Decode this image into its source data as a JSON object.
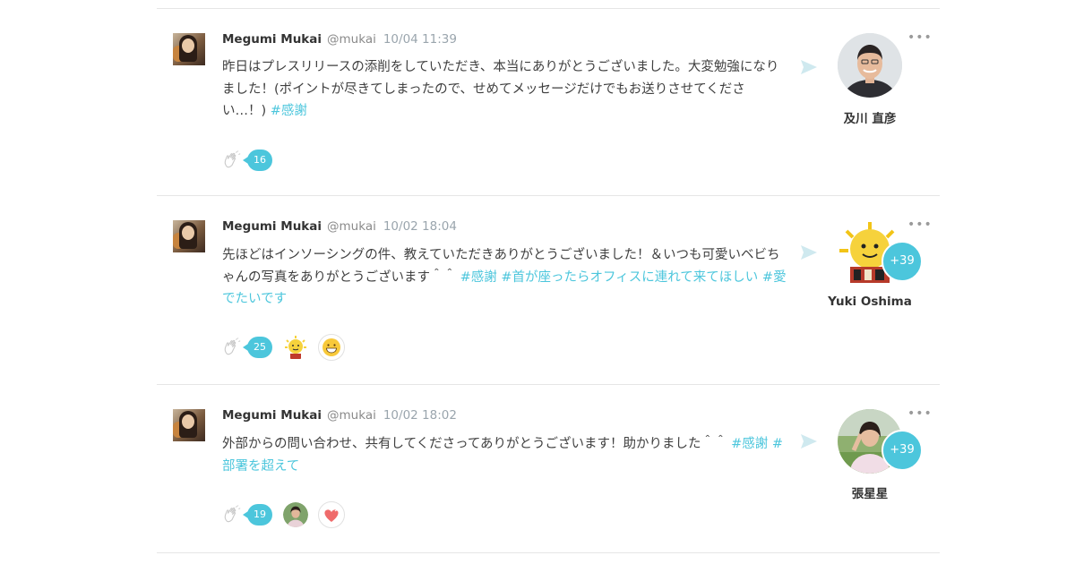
{
  "posts": [
    {
      "author": "Megumi Mukai",
      "handle": "@mukai",
      "time": "10/04 11:39",
      "body_plain": "昨日はプレスリリースの添削をしていただき、本当にありがとうございました。大変勉強になりました！(ポイントが尽きてしまったので、せめてメッセージだけでもお送りさせてください…！) ",
      "tags": [
        "#感謝"
      ],
      "clap_count": "16",
      "recipient": "及川 直彦",
      "recipient_extra": "",
      "reactions": []
    },
    {
      "author": "Megumi Mukai",
      "handle": "@mukai",
      "time": "10/02 18:04",
      "body_plain": "先ほどはインソーシングの件、教えていただきありがとうございました！＆いつも可愛いベビちゃんの写真をありがとうございます＾＾ ",
      "tags": [
        "#感謝",
        "#首が座ったらオフィスに連れて来てほしい",
        "#愛でたいです"
      ],
      "clap_count": "25",
      "recipient": "Yuki Oshima",
      "recipient_extra": "+39",
      "reactions": [
        "sun-character-icon",
        "grinning-face-icon"
      ]
    },
    {
      "author": "Megumi Mukai",
      "handle": "@mukai",
      "time": "10/02 18:02",
      "body_plain": "外部からの問い合わせ、共有してくださってありがとうございます！助かりました＾＾ ",
      "tags": [
        "#感謝",
        "#部署を超えて"
      ],
      "clap_count": "19",
      "recipient": "張星星",
      "recipient_extra": "+39",
      "reactions": [
        "user-photo-icon",
        "hearts-icon"
      ]
    }
  ],
  "icons": {
    "clap": "clapping-hands-icon",
    "send": "send-arrow-icon",
    "more": "more-dots-icon"
  },
  "more_label": "•••",
  "colors": {
    "accent": "#4cc6dc",
    "text": "#3f3f3f",
    "muted": "#9aa5ad",
    "divider": "#e6e6e6"
  }
}
